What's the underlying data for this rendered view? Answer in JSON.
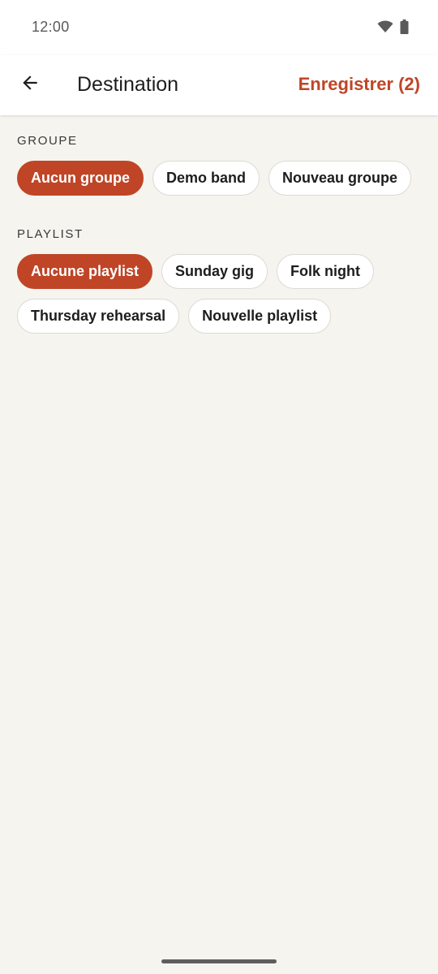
{
  "status_bar": {
    "time": "12:00",
    "wifi_icon": "wifi-icon",
    "battery_icon": "battery-icon"
  },
  "app_bar": {
    "back_icon": "arrow-back-icon",
    "title": "Destination",
    "save_label": "Enregistrer (2)"
  },
  "colors": {
    "accent": "#bf4526",
    "background": "#f6f4ef",
    "surface": "#ffffff"
  },
  "group_section": {
    "label": "GROUPE",
    "chips": [
      {
        "label": "Aucun groupe",
        "selected": true
      },
      {
        "label": "Demo band",
        "selected": false
      },
      {
        "label": "Nouveau groupe",
        "selected": false
      }
    ]
  },
  "playlist_section": {
    "label": "PLAYLIST",
    "chips": [
      {
        "label": "Aucune playlist",
        "selected": true
      },
      {
        "label": "Sunday gig",
        "selected": false
      },
      {
        "label": "Folk night",
        "selected": false
      },
      {
        "label": "Thursday rehearsal",
        "selected": false
      },
      {
        "label": "Nouvelle playlist",
        "selected": false
      }
    ]
  }
}
